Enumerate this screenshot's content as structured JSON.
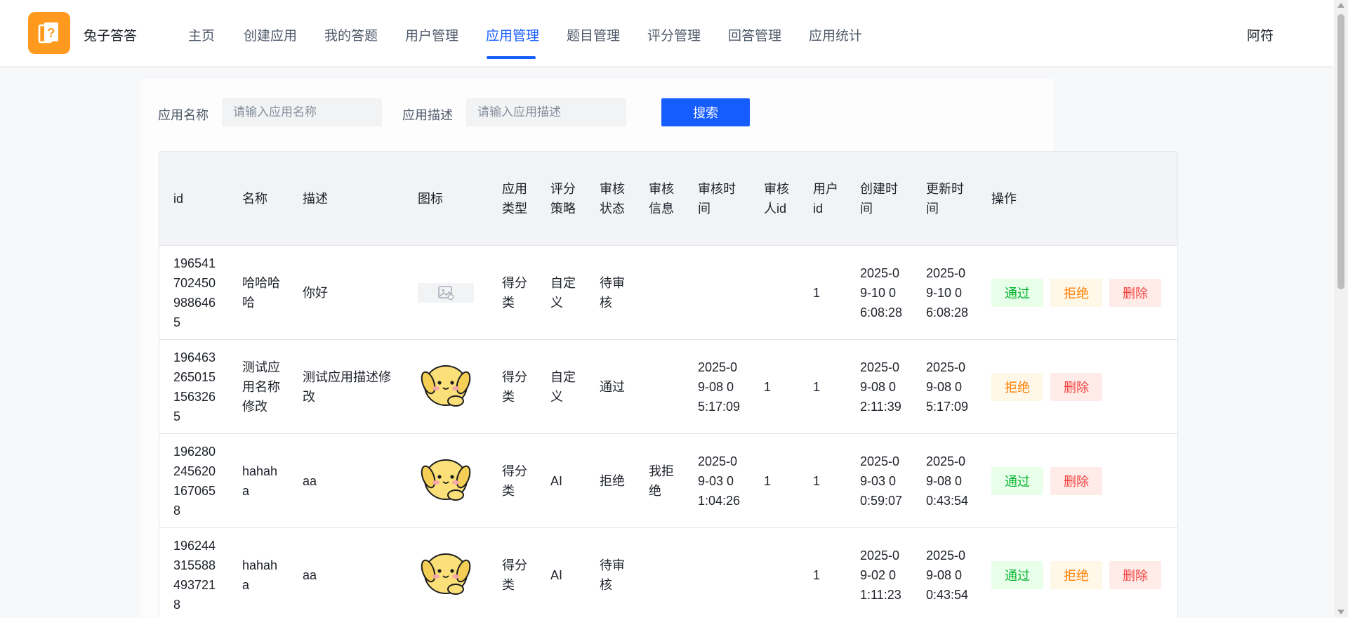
{
  "app": {
    "title": "兔子答答",
    "user_name": "阿符"
  },
  "nav": {
    "items": [
      "主页",
      "创建应用",
      "我的答题",
      "用户管理",
      "应用管理",
      "题目管理",
      "评分管理",
      "回答管理",
      "应用统计"
    ],
    "active": "应用管理"
  },
  "search": {
    "app_name_label": "应用名称",
    "app_name_placeholder": "请输入应用名称",
    "app_desc_label": "应用描述",
    "app_desc_placeholder": "请输入应用描述",
    "button_label": "搜索"
  },
  "table": {
    "columns": [
      "id",
      "名称",
      "描述",
      "图标",
      "应用类型",
      "评分策略",
      "审核状态",
      "审核信息",
      "审核时间",
      "审核人id",
      "用户id",
      "创建时间",
      "更新时间",
      "操作"
    ],
    "rows": [
      {
        "id": "1965417024509886465",
        "name": "哈哈哈哈",
        "desc": "你好",
        "icon": "image-placeholder",
        "app_type": "得分类",
        "strategy": "自定义",
        "review_status": "待审核",
        "review_msg": "",
        "review_time": "",
        "reviewer_id": "",
        "user_id": "1",
        "create_time": "2025-09-10 06:08:28",
        "update_time": "2025-09-10 06:08:28",
        "actions": [
          "通过",
          "拒绝",
          "删除"
        ]
      },
      {
        "id": "1964632650151563265",
        "name": "测试应用名称修改",
        "desc": "测试应用描述修改",
        "icon": "yellow-dog-icon",
        "app_type": "得分类",
        "strategy": "自定义",
        "review_status": "通过",
        "review_msg": "",
        "review_time": "2025-09-08 05:17:09",
        "reviewer_id": "1",
        "user_id": "1",
        "create_time": "2025-09-08 02:11:39",
        "update_time": "2025-09-08 05:17:09",
        "actions": [
          "拒绝",
          "删除"
        ]
      },
      {
        "id": "1962802456201670658",
        "name": "hahaha",
        "desc": "aa",
        "icon": "yellow-dog-icon",
        "app_type": "得分类",
        "strategy": "AI",
        "review_status": "拒绝",
        "review_msg": "我拒绝",
        "review_time": "2025-09-03 01:04:26",
        "reviewer_id": "1",
        "user_id": "1",
        "create_time": "2025-09-03 00:59:07",
        "update_time": "2025-09-08 00:43:54",
        "actions": [
          "通过",
          "删除"
        ]
      },
      {
        "id": "1962443155884937218",
        "name": "hahaha",
        "desc": "aa",
        "icon": "yellow-dog-icon",
        "app_type": "得分类",
        "strategy": "AI",
        "review_status": "待审核",
        "review_msg": "",
        "review_time": "",
        "reviewer_id": "",
        "user_id": "1",
        "create_time": "2025-09-02 01:11:23",
        "update_time": "2025-09-08 00:43:54",
        "actions": [
          "通过",
          "拒绝",
          "删除"
        ]
      }
    ]
  },
  "colors": {
    "primary": "#165dff",
    "logo_bg": "#ff9a1e",
    "pass": "#00b42a",
    "reject": "#ff7d00",
    "delete": "#f53f3f"
  }
}
